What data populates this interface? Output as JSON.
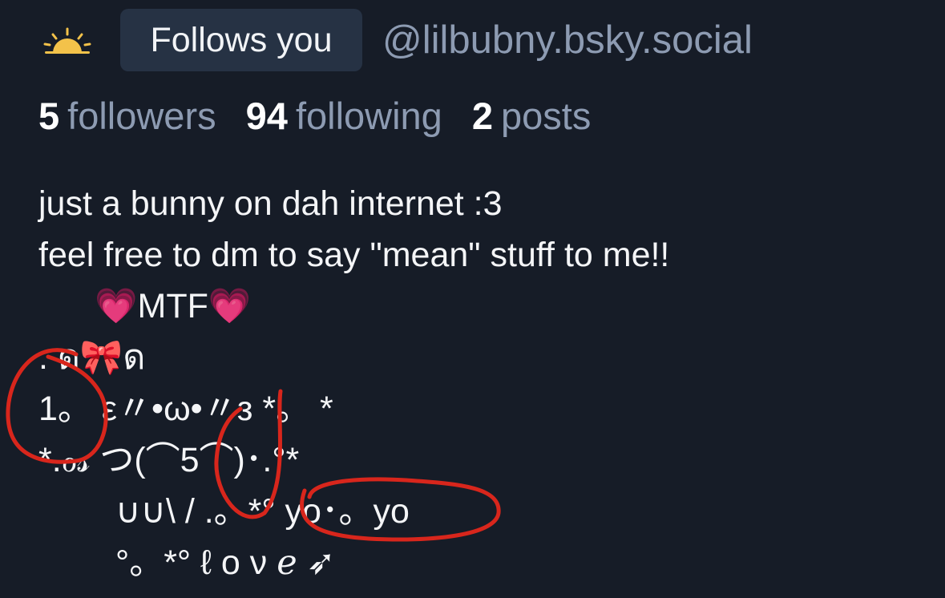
{
  "header": {
    "icon": "sunrise-icon",
    "follows_badge": "Follows you",
    "handle": "@lilbubny.bsky.social"
  },
  "stats": [
    {
      "count": "5",
      "label": "followers"
    },
    {
      "count": "94",
      "label": "following"
    },
    {
      "count": "2",
      "label": "posts"
    }
  ],
  "bio": {
    "lines": [
      "just a bunny on dah internet :3",
      "feel free to dm to say \"mean\" stuff to me!!",
      "💗MTF💗",
      ".    ด🎀ด",
      "1。 ε〃•ω•〃з *。 *",
      "*.ℴ𝓈   つ(⌒5⌒)･.°*",
      "∪∪\\ / .。*° yo･。yo",
      "°。*° ℓ ο ν ℯ ➶"
    ]
  },
  "annotations": {
    "color": "#d8261c",
    "items": [
      "red-circle-1",
      "red-circle-5",
      "red-circle-yo-yo"
    ]
  }
}
